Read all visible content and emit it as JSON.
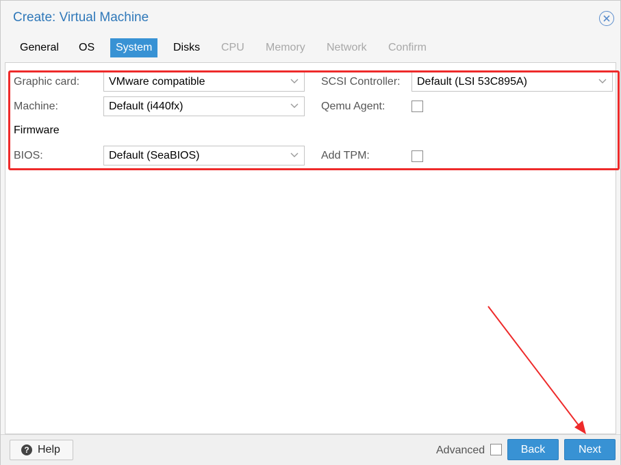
{
  "dialog": {
    "title": "Create: Virtual Machine",
    "close_icon": "close-circle-icon"
  },
  "tabs": [
    {
      "label": "General",
      "state": "normal"
    },
    {
      "label": "OS",
      "state": "normal"
    },
    {
      "label": "System",
      "state": "active"
    },
    {
      "label": "Disks",
      "state": "normal"
    },
    {
      "label": "CPU",
      "state": "disabled"
    },
    {
      "label": "Memory",
      "state": "disabled"
    },
    {
      "label": "Network",
      "state": "disabled"
    },
    {
      "label": "Confirm",
      "state": "disabled"
    }
  ],
  "form": {
    "graphic_card": {
      "label": "Graphic card:",
      "value": "VMware compatible"
    },
    "machine": {
      "label": "Machine:",
      "value": "Default (i440fx)"
    },
    "firmware_heading": "Firmware",
    "bios": {
      "label": "BIOS:",
      "value": "Default (SeaBIOS)"
    },
    "scsi_controller": {
      "label": "SCSI Controller:",
      "value": "Default (LSI 53C895A)"
    },
    "qemu_agent": {
      "label": "Qemu Agent:",
      "checked": false
    },
    "add_tpm": {
      "label": "Add TPM:",
      "checked": false
    }
  },
  "footer": {
    "help_label": "Help",
    "advanced_label": "Advanced",
    "advanced_checked": false,
    "back_label": "Back",
    "next_label": "Next"
  },
  "colors": {
    "accent": "#3892d4",
    "title": "#2f78b9",
    "annotation": "#ee2a2a"
  }
}
